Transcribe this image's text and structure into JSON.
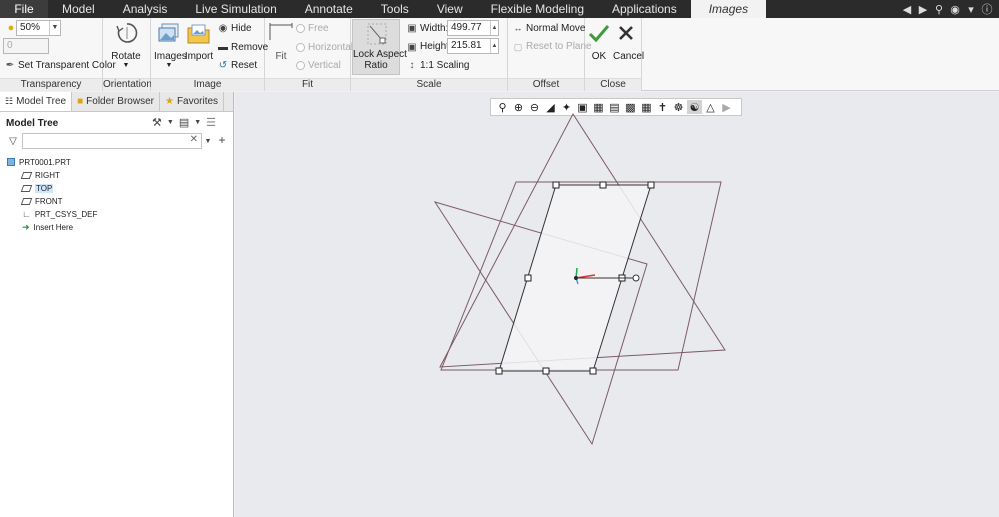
{
  "menubar": {
    "items": [
      "File",
      "Analysis",
      "Live Simulation",
      "Annotate",
      "Tools",
      "View",
      "Flexible Modeling",
      "Applications",
      "Images"
    ],
    "model": "Model",
    "active": "Images"
  },
  "ribbon": {
    "transparency": {
      "value": "50%",
      "secondary": "0",
      "set_label": "Set Transparent Color",
      "group": "Transparency"
    },
    "orientation": {
      "rotate": "Rotate",
      "group": "Orientation"
    },
    "image": {
      "images": "Images",
      "import": "Import",
      "hide": "Hide",
      "remove": "Remove",
      "reset": "Reset",
      "group": "Image"
    },
    "fit": {
      "fit": "Fit",
      "free": "Free",
      "horizontal": "Horizontal",
      "vertical": "Vertical",
      "group": "Fit"
    },
    "scale": {
      "lock_line1": "Lock Aspect",
      "lock_line2": "Ratio",
      "width_label": "Width:",
      "width_value": "499.77",
      "height_label": "Height:",
      "height_value": "215.81",
      "scaling": "1:1 Scaling",
      "group": "Scale"
    },
    "offset": {
      "normal_move": "Normal Move",
      "reset_plane": "Reset to Plane",
      "group": "Offset"
    },
    "close": {
      "ok": "OK",
      "cancel": "Cancel",
      "group": "Close"
    }
  },
  "sidebar": {
    "tabs": [
      "Model Tree",
      "Folder Browser",
      "Favorites"
    ],
    "title": "Model Tree",
    "nodes": [
      "PRT0001.PRT",
      "RIGHT",
      "TOP",
      "FRONT",
      "PRT_CSYS_DEF",
      "Insert Here"
    ],
    "selected": "TOP"
  },
  "colors": {
    "accent": "#2f6fb0",
    "ok_green": "#3f9a3f",
    "plane_line": "#7b5b63"
  }
}
